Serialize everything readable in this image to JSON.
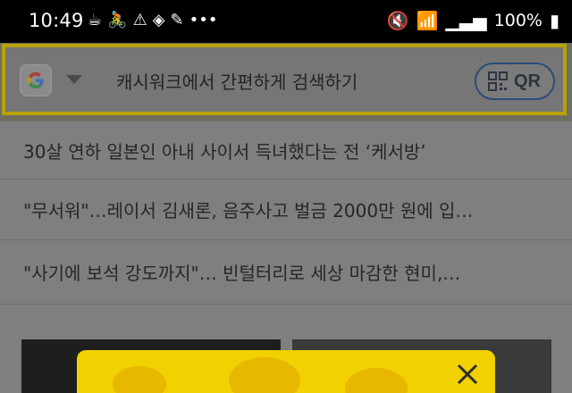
{
  "status": {
    "time": "10:49",
    "battery": "100%"
  },
  "search": {
    "placeholder": "캐시워크에서 간편하게 검색하기",
    "qr_label": "QR"
  },
  "news": [
    "30살 연하 일본인 아내 사이서 득녀했다는 전 ‘케서방’",
    "\"무서워\"…레이서 김새론, 음주사고 벌금 2000만 원에 입…",
    "\"사기에 보석 강도까지\"… 빈털터리로 세상 마감한 현미,…"
  ],
  "icons": {
    "google": "google-icon",
    "dropdown": "chevron-down-icon",
    "qr": "qr-icon",
    "close": "close-icon"
  }
}
